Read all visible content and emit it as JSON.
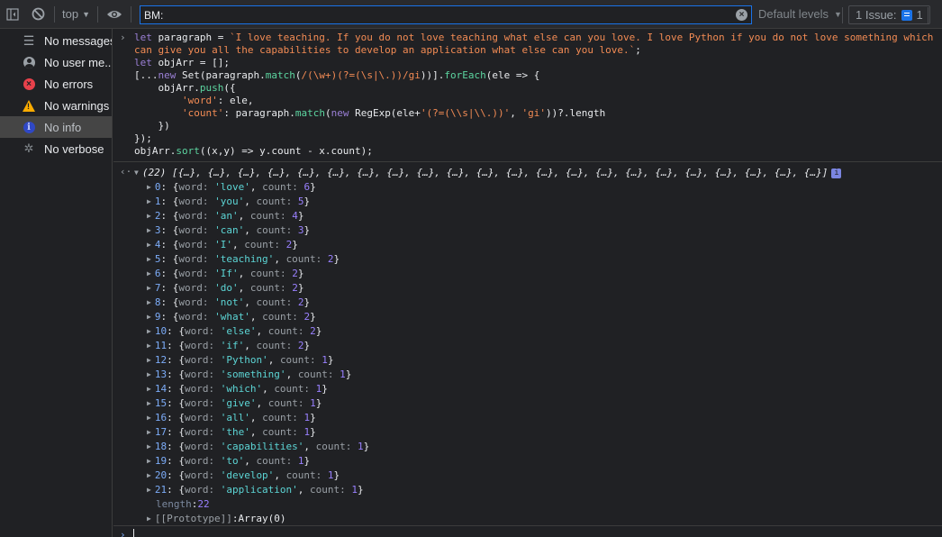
{
  "toolbar": {
    "context": "top",
    "filter_value": "BM:",
    "levels_label": "Default levels",
    "issues_label": "1 Issue:",
    "issues_count": "1"
  },
  "sidebar": {
    "items": [
      {
        "label": "No messages",
        "icon": "list-icon"
      },
      {
        "label": "No user me...",
        "icon": "user-icon"
      },
      {
        "label": "No errors",
        "icon": "error-icon"
      },
      {
        "label": "No warnings",
        "icon": "warning-icon"
      },
      {
        "label": "No info",
        "icon": "info-icon",
        "active": true
      },
      {
        "label": "No verbose",
        "icon": "bug-icon"
      }
    ]
  },
  "console": {
    "code": {
      "l1_a": "let",
      "l1_b": " paragraph = ",
      "l1_str": "`I love teaching. If you do not love teaching what else can you love. I love Python if you do not love something which",
      "l2_str": "can give you all the capabilities to develop an application what else can you love.`",
      "l2_end": ";",
      "l3_a": "let",
      "l3_b": " objArr = [];",
      "l4_a": "[...",
      "l4_new": "new",
      "l4_b": " Set(paragraph.",
      "l4_match": "match",
      "l4_c": "(",
      "l4_rx": "/(\\w+)(?=(\\s|\\.))/gi",
      "l4_d": "))].",
      "l4_foreach": "forEach",
      "l4_e": "(ele => {",
      "l5_a": "    objArr.",
      "l5_push": "push",
      "l5_b": "({",
      "l6_key": "'word'",
      "l6_b": ": ele,",
      "l7_key": "'count'",
      "l7_b": ": paragraph.",
      "l7_match": "match",
      "l7_c": "(",
      "l7_new": "new",
      "l7_d": " RegExp(ele+",
      "l7_str": "'(?=(\\\\s|\\\\.))'",
      "l7_e": ", ",
      "l7_gi": "'gi'",
      "l7_f": "))?.length",
      "l8": "    })",
      "l9": "});",
      "l10_a": "objArr.",
      "l10_sort": "sort",
      "l10_b": "((x,y) => y.count - x.count);"
    },
    "result_summary": "(22) [{…}, {…}, {…}, {…}, {…}, {…}, {…}, {…}, {…}, {…}, {…}, {…}, {…}, {…}, {…}, {…}, {…}, {…}, {…}, {…}, {…}, {…}]",
    "items": [
      {
        "index": "0",
        "word": "'love'",
        "count": "6"
      },
      {
        "index": "1",
        "word": "'you'",
        "count": "5"
      },
      {
        "index": "2",
        "word": "'an'",
        "count": "4"
      },
      {
        "index": "3",
        "word": "'can'",
        "count": "3"
      },
      {
        "index": "4",
        "word": "'I'",
        "count": "2"
      },
      {
        "index": "5",
        "word": "'teaching'",
        "count": "2"
      },
      {
        "index": "6",
        "word": "'If'",
        "count": "2"
      },
      {
        "index": "7",
        "word": "'do'",
        "count": "2"
      },
      {
        "index": "8",
        "word": "'not'",
        "count": "2"
      },
      {
        "index": "9",
        "word": "'what'",
        "count": "2"
      },
      {
        "index": "10",
        "word": "'else'",
        "count": "2"
      },
      {
        "index": "11",
        "word": "'if'",
        "count": "2"
      },
      {
        "index": "12",
        "word": "'Python'",
        "count": "1"
      },
      {
        "index": "13",
        "word": "'something'",
        "count": "1"
      },
      {
        "index": "14",
        "word": "'which'",
        "count": "1"
      },
      {
        "index": "15",
        "word": "'give'",
        "count": "1"
      },
      {
        "index": "16",
        "word": "'all'",
        "count": "1"
      },
      {
        "index": "17",
        "word": "'the'",
        "count": "1"
      },
      {
        "index": "18",
        "word": "'capabilities'",
        "count": "1"
      },
      {
        "index": "19",
        "word": "'to'",
        "count": "1"
      },
      {
        "index": "20",
        "word": "'develop'",
        "count": "1"
      },
      {
        "index": "21",
        "word": "'application'",
        "count": "1"
      }
    ],
    "length_key": "length",
    "length_value": "22",
    "proto_key": "[[Prototype]]",
    "proto_value": "Array(0)"
  }
}
